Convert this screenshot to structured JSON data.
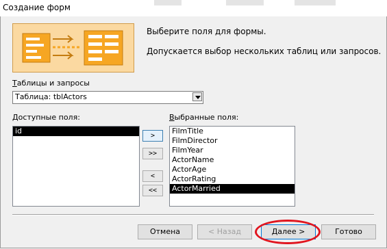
{
  "window": {
    "title": "Создание форм"
  },
  "description": {
    "line1": "Выберите поля для формы.",
    "line2": "Допускается выбор нескольких таблиц или запросов."
  },
  "source": {
    "label": "Таблицы и запросы",
    "label_access_key": "Т",
    "label_rest": "аблицы и запросы",
    "selected": "Таблица: tblActors"
  },
  "available": {
    "label_access_key": "Д",
    "label_rest": "оступные поля:",
    "items": [
      "id"
    ],
    "selected_index": 0
  },
  "selected_fields": {
    "label_access_key": "В",
    "label_rest": "ыбранные поля:",
    "items": [
      "FilmTitle",
      "FilmDirector",
      "FilmYear",
      "ActorName",
      "ActorAge",
      "ActorRating",
      "ActorMarried"
    ],
    "selected_index": 6
  },
  "move_buttons": {
    "add_one": ">",
    "add_all": ">>",
    "remove_one": "<",
    "remove_all": "<<"
  },
  "footer": {
    "cancel": "Отмена",
    "back": "< Назад",
    "next": "Далее >",
    "finish": "Готово"
  },
  "colors": {
    "annotation": "#e0151f",
    "selection": "#000000",
    "image_fill": "#fbd9a1"
  }
}
